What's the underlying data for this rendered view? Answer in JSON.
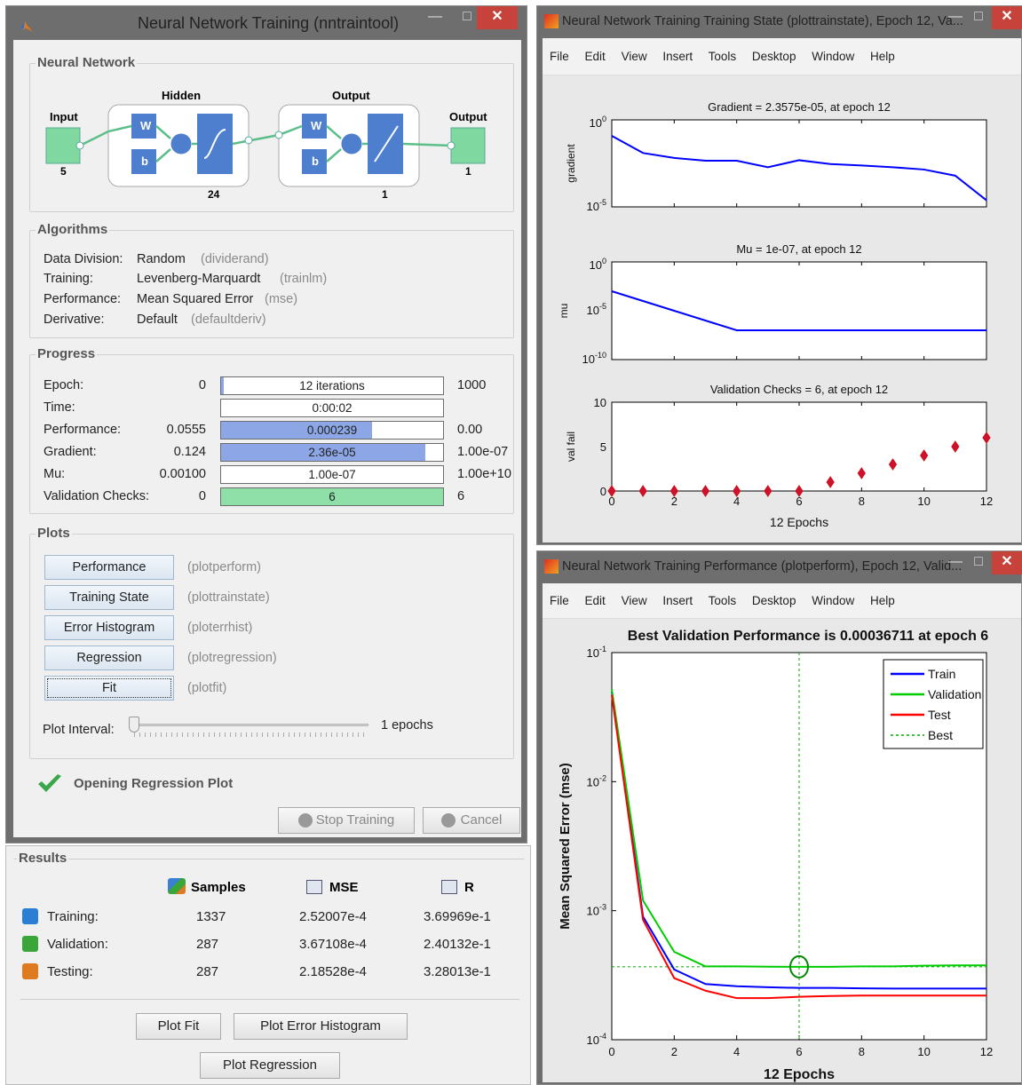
{
  "nntraintool": {
    "title": "Neural Network Training (nntraintool)",
    "network": {
      "group_title": "Neural Network",
      "hidden_label": "Hidden",
      "output_label": "Output",
      "input_label": "Input",
      "output_node_label": "Output",
      "input_count": "5",
      "hidden_count": "24",
      "output_count": "1",
      "output_node_count": "1",
      "w": "W",
      "b": "b"
    },
    "algorithms": {
      "group_title": "Algorithms",
      "rows": [
        {
          "label": "Data Division:",
          "value": "Random",
          "fn": "(dividerand)"
        },
        {
          "label": "Training:",
          "value": "Levenberg-Marquardt",
          "fn": "(trainlm)"
        },
        {
          "label": "Performance:",
          "value": "Mean Squared Error",
          "fn": "(mse)"
        },
        {
          "label": "Derivative:",
          "value": "Default",
          "fn": "(defaultderiv)"
        }
      ]
    },
    "progress": {
      "group_title": "Progress",
      "rows": [
        {
          "label": "Epoch:",
          "start": "0",
          "value": "12 iterations",
          "end": "1000",
          "fill": 0.012
        },
        {
          "label": "Time:",
          "start": "",
          "value": "0:00:02",
          "end": "",
          "fill": 0
        },
        {
          "label": "Performance:",
          "start": "0.0555",
          "value": "0.000239",
          "end": "0.00",
          "fill": 0.68
        },
        {
          "label": "Gradient:",
          "start": "0.124",
          "value": "2.36e-05",
          "end": "1.00e-07",
          "fill": 0.92
        },
        {
          "label": "Mu:",
          "start": "0.00100",
          "value": "1.00e-07",
          "end": "1.00e+10",
          "fill": 0
        },
        {
          "label": "Validation Checks:",
          "start": "0",
          "value": "6",
          "end": "6",
          "fill": 1.0
        }
      ],
      "blue_fill": "#8ca6e6",
      "green_fill": "#8ee0a8"
    },
    "plots": {
      "group_title": "Plots",
      "buttons": [
        {
          "label": "Performance",
          "fn": "(plotperform)"
        },
        {
          "label": "Training State",
          "fn": "(plottrainstate)"
        },
        {
          "label": "Error Histogram",
          "fn": "(ploterrhist)"
        },
        {
          "label": "Regression",
          "fn": "(plotregression)"
        },
        {
          "label": "Fit",
          "fn": "(plotfit)"
        }
      ],
      "interval_label": "Plot Interval:",
      "interval_value": "1 epochs"
    },
    "status": "Opening Regression Plot",
    "stop_button": "Stop Training",
    "cancel_button": "Cancel"
  },
  "results": {
    "group_title": "Results",
    "headers": {
      "samples": "Samples",
      "mse": "MSE",
      "r": "R"
    },
    "rows": [
      {
        "label": "Training:",
        "samples": "1337",
        "mse": "2.52007e-4",
        "r": "3.69969e-1",
        "color": "#2a7fd4"
      },
      {
        "label": "Validation:",
        "samples": "287",
        "mse": "3.67108e-4",
        "r": "2.40132e-1",
        "color": "#3aa63a"
      },
      {
        "label": "Testing:",
        "samples": "287",
        "mse": "2.18528e-4",
        "r": "3.28013e-1",
        "color": "#e07a20"
      }
    ],
    "plot_fit": "Plot Fit",
    "plot_error_histogram": "Plot Error Histogram",
    "plot_regression": "Plot Regression"
  },
  "trainstate": {
    "title": "Neural Network Training Training State (plottrainstate), Epoch 12, Va...",
    "menu": [
      "File",
      "Edit",
      "View",
      "Insert",
      "Tools",
      "Desktop",
      "Window",
      "Help"
    ],
    "xlabel": "12 Epochs"
  },
  "perform": {
    "title": "Neural Network Training Performance (plotperform), Epoch 12, Valid...",
    "menu": [
      "File",
      "Edit",
      "View",
      "Insert",
      "Tools",
      "Desktop",
      "Window",
      "Help"
    ]
  },
  "chart_data": [
    {
      "type": "line",
      "title": "Gradient = 2.3575e-05, at epoch 12",
      "ylabel": "gradient",
      "yscale": "log",
      "ylim": [
        1e-05,
        1
      ],
      "xlim": [
        0,
        12
      ],
      "x": [
        0,
        1,
        2,
        3,
        4,
        5,
        6,
        7,
        8,
        9,
        10,
        11,
        12
      ],
      "values": [
        0.12,
        0.0125,
        0.0065,
        0.0045,
        0.0045,
        0.0019,
        0.0048,
        0.0029,
        0.0024,
        0.0019,
        0.0014,
        0.00062,
        2.4e-05
      ],
      "color": "#0000ff"
    },
    {
      "type": "line",
      "title": "Mu = 1e-07, at epoch 12",
      "ylabel": "mu",
      "yscale": "log",
      "ylim": [
        1e-10,
        1
      ],
      "xlim": [
        0,
        12
      ],
      "x": [
        0,
        1,
        2,
        3,
        4,
        5,
        6,
        7,
        8,
        9,
        10,
        11,
        12
      ],
      "values": [
        0.001,
        0.0001,
        1e-05,
        1e-06,
        1e-07,
        1e-07,
        1e-07,
        1e-07,
        1e-07,
        1e-07,
        1e-07,
        1e-07,
        1e-07
      ],
      "color": "#0000ff"
    },
    {
      "type": "scatter",
      "title": "Validation Checks = 6, at epoch 12",
      "ylabel": "val fail",
      "xlabel": "12 Epochs",
      "ylim": [
        0,
        10
      ],
      "xlim": [
        0,
        12
      ],
      "x": [
        0,
        1,
        2,
        3,
        4,
        5,
        6,
        7,
        8,
        9,
        10,
        11,
        12
      ],
      "values": [
        0,
        0,
        0,
        0,
        0,
        0,
        0,
        1,
        2,
        3,
        4,
        5,
        6
      ],
      "color": "#cc1133"
    },
    {
      "type": "line",
      "title": "Best Validation Performance is 0.00036711 at epoch 6",
      "xlabel": "12 Epochs",
      "ylabel": "Mean Squared Error  (mse)",
      "yscale": "log",
      "ylim": [
        0.0001,
        0.1
      ],
      "xlim": [
        0,
        12
      ],
      "legend": "top-right",
      "x": [
        0,
        1,
        2,
        3,
        4,
        5,
        6,
        7,
        8,
        9,
        10,
        11,
        12
      ],
      "series": [
        {
          "name": "Train",
          "color": "#0000ff",
          "values": [
            0.05,
            0.0009,
            0.00035,
            0.00027,
            0.00026,
            0.000255,
            0.000252,
            0.000252,
            0.00025,
            0.000249,
            0.000249,
            0.000249,
            0.000249
          ]
        },
        {
          "name": "Validation",
          "color": "#00cc00",
          "values": [
            0.052,
            0.0012,
            0.00048,
            0.00037,
            0.00037,
            0.000368,
            0.000367,
            0.000367,
            0.00037,
            0.00037,
            0.000375,
            0.000377,
            0.000377
          ]
        },
        {
          "name": "Test",
          "color": "#ff0000",
          "values": [
            0.047,
            0.00085,
            0.0003,
            0.00024,
            0.00021,
            0.00021,
            0.000215,
            0.000218,
            0.00022,
            0.00022,
            0.00022,
            0.00022,
            0.00022
          ]
        }
      ],
      "best": {
        "name": "Best",
        "epoch": 6,
        "value": 0.00036711
      }
    }
  ]
}
